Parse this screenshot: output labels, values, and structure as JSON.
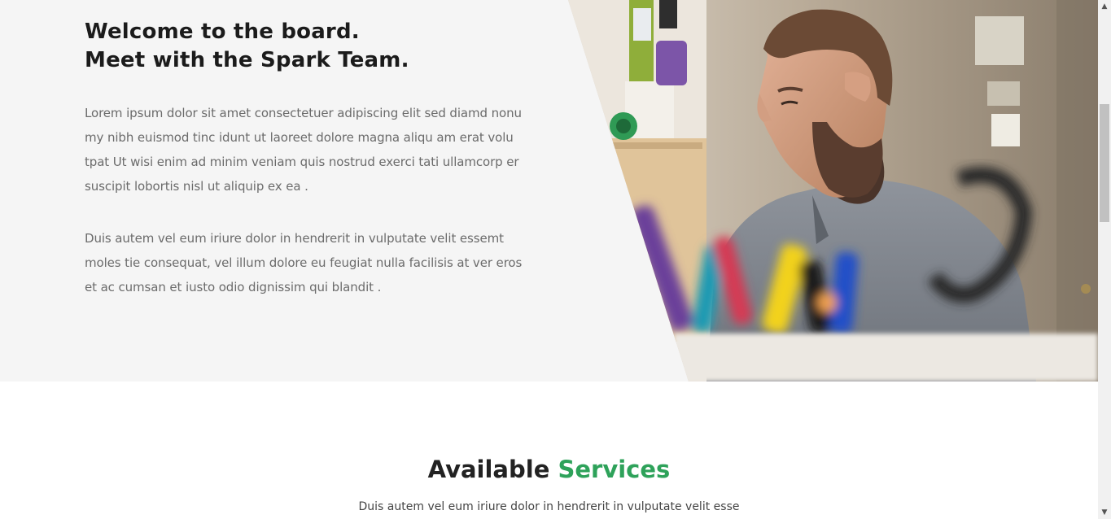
{
  "about": {
    "title_line1": "Welcome to the board.",
    "title_line2": "Meet with the Spark Team.",
    "paragraph1": "Lorem ipsum dolor sit amet consectetuer adipiscing elit sed diamd nonu my nibh euismod tinc idunt ut laoreet dolore magna aliqu am erat volu tpat Ut wisi enim ad minim veniam quis nostrud exerci tati ullamcorp er suscipit lobortis nisl ut aliquip ex ea .",
    "paragraph2": "Duis autem vel eum iriure dolor in hendrerit in vulputate velit essemt moles tie consequat, vel illum dolore eu feugiat nulla facilisis at ver eros et ac cumsan et iusto odio dignissim qui blandit ."
  },
  "services": {
    "title_part1": "Available",
    "title_part2": "Services",
    "subtitle": "Duis autem vel eum iriure dolor in hendrerit in vulputate velit esse"
  },
  "scrollbar": {
    "up_icon": "▲",
    "down_icon": "▼"
  },
  "colors": {
    "accent": "#2ea25a",
    "heading": "#1b1b1b",
    "body_text": "#6b6b6b",
    "section_bg": "#f5f5f5"
  }
}
